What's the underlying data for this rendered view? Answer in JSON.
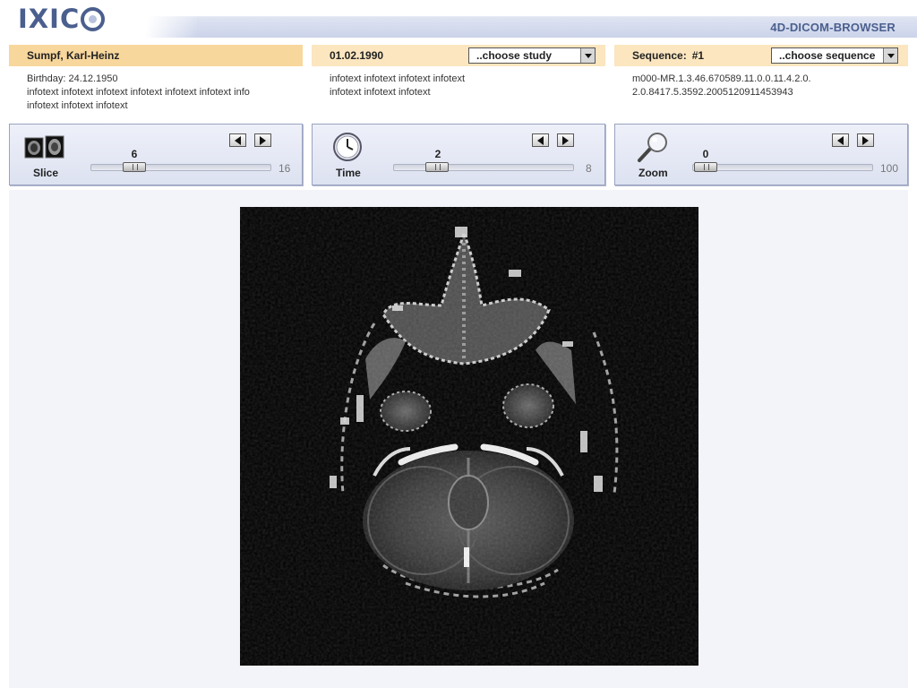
{
  "header": {
    "logo_text": "IXIC",
    "app_title": "4D-DICOM-BROWSER"
  },
  "patient": {
    "name": "Sumpf, Karl-Heinz",
    "birthday": "Birthday: 24.12.1950",
    "info_line1": "infotext infotext infotext infotext infotext infotext info",
    "info_line2": "infotext infotext infotext"
  },
  "study": {
    "date": "01.02.1990",
    "select_value": "..choose study",
    "info_line1": "infotext infotext infotext infotext",
    "info_line2": "infotext infotext infotext"
  },
  "sequence": {
    "label": "Sequence:",
    "number": "#1",
    "select_value": "..choose sequence",
    "uid_line1": "m000-MR.1.3.46.670589.11.0.0.11.4.2.0.",
    "uid_line2": "2.0.8417.5.3592.2005120911453943"
  },
  "controls": {
    "slice": {
      "label": "Slice",
      "value": "6",
      "max": "16",
      "icon": "slice-stack-icon",
      "fraction": 0.375
    },
    "time": {
      "label": "Time",
      "value": "2",
      "max": "8",
      "icon": "clock-icon",
      "fraction": 0.25
    },
    "zoom": {
      "label": "Zoom",
      "value": "0",
      "max": "100",
      "icon": "magnifier-icon",
      "fraction": 0.0
    }
  },
  "viewer": {
    "image": "axial-mri-brain-slice"
  },
  "colors": {
    "brand": "#4a5f8e",
    "patient_bar": "#f8d79d",
    "info_bar": "#fbe6bf",
    "panel": "#dde2f1",
    "viewer_bg": "#f3f4fa"
  }
}
